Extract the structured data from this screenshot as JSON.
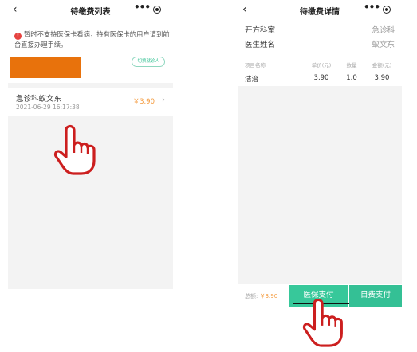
{
  "list_page": {
    "title": "待缴费列表",
    "back_icon": "‹",
    "capsule": {
      "more": "•••"
    },
    "notice": "暂时不支持医保卡看病，持有医保卡的用户请到前台直接办理手续。",
    "notice_icon": "!",
    "switch_patient_label": "切换就诊人",
    "item": {
      "title": "急诊科蚁文东",
      "time": "2021-06-29 16:17:38",
      "amount": "￥3.90",
      "arrow": "›"
    }
  },
  "detail_page": {
    "title": "待缴费详情",
    "back_icon": "‹",
    "capsule": {
      "more": "•••"
    },
    "fields": [
      {
        "label": "开方科室",
        "value": "急诊科"
      },
      {
        "label": "医生姓名",
        "value": "蚁文东"
      }
    ],
    "table": {
      "headers": [
        "项目名称",
        "单价(元)",
        "数量",
        "金额(元)"
      ],
      "rows": [
        {
          "name": "洁治",
          "price": "3.90",
          "qty": "1.0",
          "amount": "3.90"
        }
      ]
    },
    "footer": {
      "total_label": "总额:",
      "total_value": "￥3.90",
      "insurance_pay_label": "医保支付",
      "self_pay_label": "自费支付"
    }
  },
  "colors": {
    "accent_green": "#37c89a",
    "amount_orange": "#f49a3c",
    "redaction": "#e8720c",
    "hand_red": "#cc1f1f"
  }
}
